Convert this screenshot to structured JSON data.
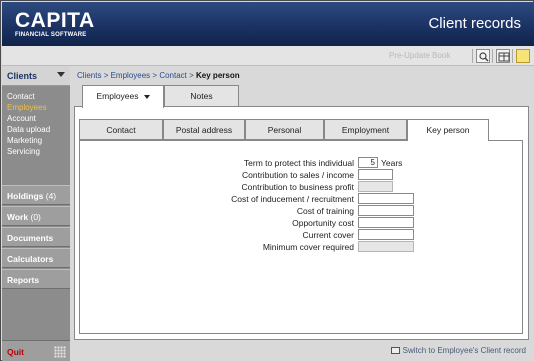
{
  "header": {
    "brand": "CAPITA",
    "brand_sub": "FINANCIAL SOFTWARE",
    "app_title": "Client records"
  },
  "toolbar": {
    "faded_text": "Pre-Update Book",
    "icons": [
      "zoom-icon",
      "grid-icon",
      "note-icon"
    ]
  },
  "sidebar": {
    "header": "Clients",
    "subitems": [
      {
        "label": "Contact",
        "active": false
      },
      {
        "label": "Employees",
        "active": true
      },
      {
        "label": "Account",
        "active": false
      },
      {
        "label": "Data upload",
        "active": false
      },
      {
        "label": "Marketing",
        "active": false
      },
      {
        "label": "Servicing",
        "active": false
      }
    ],
    "sections": [
      {
        "label": "Holdings",
        "count": "(4)"
      },
      {
        "label": "Work",
        "count": "(0)"
      },
      {
        "label": "Documents",
        "count": ""
      },
      {
        "label": "Calculators",
        "count": ""
      },
      {
        "label": "Reports",
        "count": ""
      }
    ],
    "quit": "Quit"
  },
  "breadcrumb": {
    "items": [
      "Clients",
      "Employees",
      "Contact"
    ],
    "separator": ">",
    "current": "Key person"
  },
  "top_tabs": {
    "employees": "Employees",
    "notes": "Notes"
  },
  "sub_tabs": [
    "Contact",
    "Postal address",
    "Personal",
    "Employment",
    "Key person"
  ],
  "form": {
    "fields": [
      {
        "label": "Term to protect this individual",
        "value": "5",
        "unit": "Years"
      },
      {
        "label": "Contribution to sales / income",
        "value": ""
      },
      {
        "label": "Contribution to business profit",
        "value": ""
      },
      {
        "label": "Cost of inducement / recruitment",
        "value": ""
      },
      {
        "label": "Cost of training",
        "value": ""
      },
      {
        "label": "Opportunity cost",
        "value": ""
      },
      {
        "label": "Current cover",
        "value": ""
      },
      {
        "label": "Minimum cover required",
        "value": ""
      }
    ]
  },
  "footer": {
    "switch_text": "Switch to Employee's Client record"
  },
  "colors": {
    "header_blue": "#1b3364",
    "active_link": "#f0c040",
    "quit_red": "#c00000"
  }
}
